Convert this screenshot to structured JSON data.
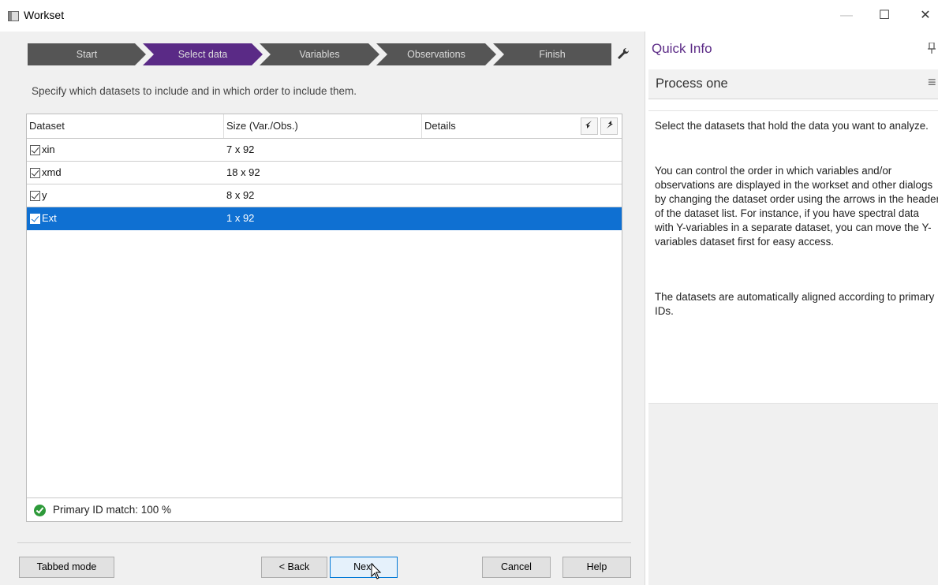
{
  "window": {
    "title": "Workset",
    "minimize_glyph": "—",
    "maximize_glyph": "☐",
    "close_glyph": "✕"
  },
  "steps": [
    {
      "label": "Start",
      "active": false
    },
    {
      "label": "Select data",
      "active": true
    },
    {
      "label": "Variables",
      "active": false
    },
    {
      "label": "Observations",
      "active": false
    },
    {
      "label": "Finish",
      "active": false
    }
  ],
  "colors": {
    "step_inactive": "#555555",
    "step_active": "#5a2a86",
    "selection": "#0f70d2",
    "quick_info_title": "#5b2a86",
    "ok_green": "#2e9a3a"
  },
  "instruction": "Specify which datasets to include and in which order to include them.",
  "table": {
    "columns": [
      "Dataset",
      "Size (Var./Obs.)",
      "Details"
    ],
    "move_down_glyph": "🡐",
    "move_up_glyph": "🡒",
    "rows": [
      {
        "name": "xin",
        "size": "7 x 92",
        "checked": true,
        "selected": false
      },
      {
        "name": "xmd",
        "size": "18 x 92",
        "checked": true,
        "selected": false
      },
      {
        "name": "y",
        "size": "8 x 92",
        "checked": true,
        "selected": false
      },
      {
        "name": "Ext",
        "size": "1 x 92",
        "checked": true,
        "selected": true
      }
    ],
    "footer_status": "Primary ID match: 100 %"
  },
  "buttons": {
    "tabbed_mode": "Tabbed mode",
    "back": "< Back",
    "next": "Next",
    "cancel": "Cancel",
    "help": "Help"
  },
  "quick_info": {
    "title": "Quick Info",
    "subtitle": "Process one",
    "pin_glyph": "↕",
    "menu_glyph": "≡",
    "paragraphs": [
      "Select the datasets that hold the data you want to analyze.",
      "You can control the order in which variables and/or observations are displayed in the workset and other dialogs by changing the dataset order using the arrows in the header of the dataset list. For instance, if you have spectral data with Y-variables in a separate dataset, you can move the Y-variables dataset first for easy access.",
      "The datasets are automatically aligned according to primary IDs."
    ]
  }
}
